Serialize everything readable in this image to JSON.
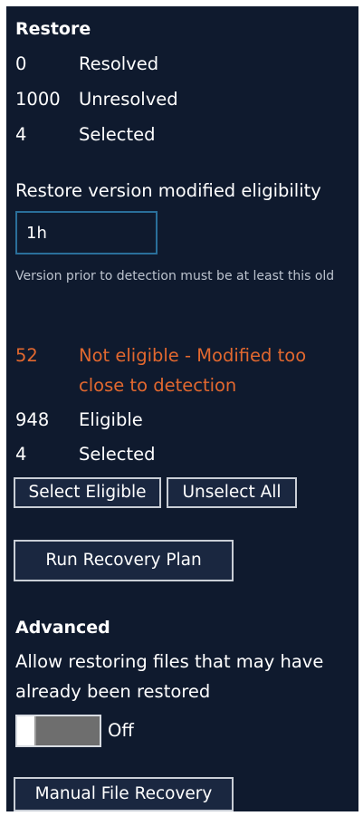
{
  "restore": {
    "heading": "Restore",
    "stats": [
      {
        "count": "0",
        "label": "Resolved"
      },
      {
        "count": "1000",
        "label": "Unresolved"
      },
      {
        "count": "4",
        "label": "Selected"
      }
    ]
  },
  "eligibility": {
    "label": "Restore version modified eligibility",
    "value": "1h",
    "hint": "Version prior to detection must be at least this old",
    "not_eligible_count": "52",
    "not_eligible_label_line1": "Not eligible - Modified too",
    "not_eligible_label_line2": "close to detection",
    "eligible_count": "948",
    "eligible_label": "Eligible",
    "selected_count": "4",
    "selected_label": "Selected",
    "select_eligible_label": "Select Eligible",
    "unselect_all_label": "Unselect All",
    "warning_color": "#e2682f"
  },
  "run_recovery_plan_label": "Run Recovery Plan",
  "advanced": {
    "heading": "Advanced",
    "description_line1": "Allow restoring files that may have",
    "description_line2": "already been restored",
    "toggle_state": "Off"
  },
  "manual_file_recovery_label": "Manual File Recovery",
  "colors": {
    "panel_background": "#0f1a2e",
    "input_border": "#2a6f9a",
    "text": "#ffffff"
  }
}
